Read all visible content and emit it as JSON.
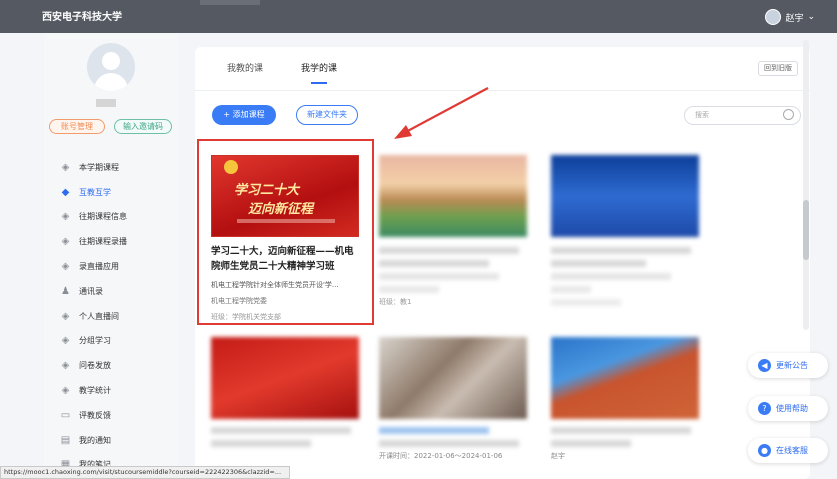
{
  "topbar": {
    "school": "西安电子科技大学",
    "user_name": "赵宇"
  },
  "profile": {
    "account_btn": "账号管理",
    "invite_btn": "输入邀请码"
  },
  "menu": [
    {
      "label": "本学期课程",
      "icon": "diamond-icon"
    },
    {
      "label": "互教互学",
      "icon": "diamond-icon",
      "active": true
    },
    {
      "label": "往期课程信息",
      "icon": "diamond-icon"
    },
    {
      "label": "往期课程录播",
      "icon": "diamond-icon"
    },
    {
      "label": "录直播应用",
      "icon": "diamond-icon"
    },
    {
      "label": "通讯录",
      "icon": "contacts-icon"
    },
    {
      "label": "个人直播间",
      "icon": "diamond-icon"
    },
    {
      "label": "分组学习",
      "icon": "diamond-icon"
    },
    {
      "label": "问卷发放",
      "icon": "diamond-icon"
    },
    {
      "label": "教学统计",
      "icon": "diamond-icon"
    },
    {
      "label": "评教反馈",
      "icon": "feedback-icon"
    },
    {
      "label": "我的通知",
      "icon": "notice-icon"
    },
    {
      "label": "我的笔记",
      "icon": "note-icon"
    }
  ],
  "tabs": [
    "我教的课",
    "我学的课"
  ],
  "old_version": "回到旧版",
  "add_course": "+ 添加课程",
  "new_folder": "新建文件夹",
  "search_placeholder": "搜索",
  "course1": {
    "cover_line1": "学习二十大",
    "cover_line2": "迈向新征程",
    "title": "学习二十大，迈向新征程——机电院师生党员二十大精神学习班",
    "desc": "机电工程学院针对全体师生党员开设'学...",
    "teacher": "机电工程学院党委",
    "class": "班级：学院机关党支部"
  },
  "course2_class": "班级：教1",
  "course5_time": "开课时间：2022-01-06～2024-01-06",
  "course6_teacher": "赵宇",
  "float": {
    "announce": "更新公告",
    "help": "使用帮助",
    "service": "在线客服"
  },
  "status_url": "https://mooc1.chaoxing.com/visit/stucoursemiddle?courseid=222422306&clazzid=..."
}
